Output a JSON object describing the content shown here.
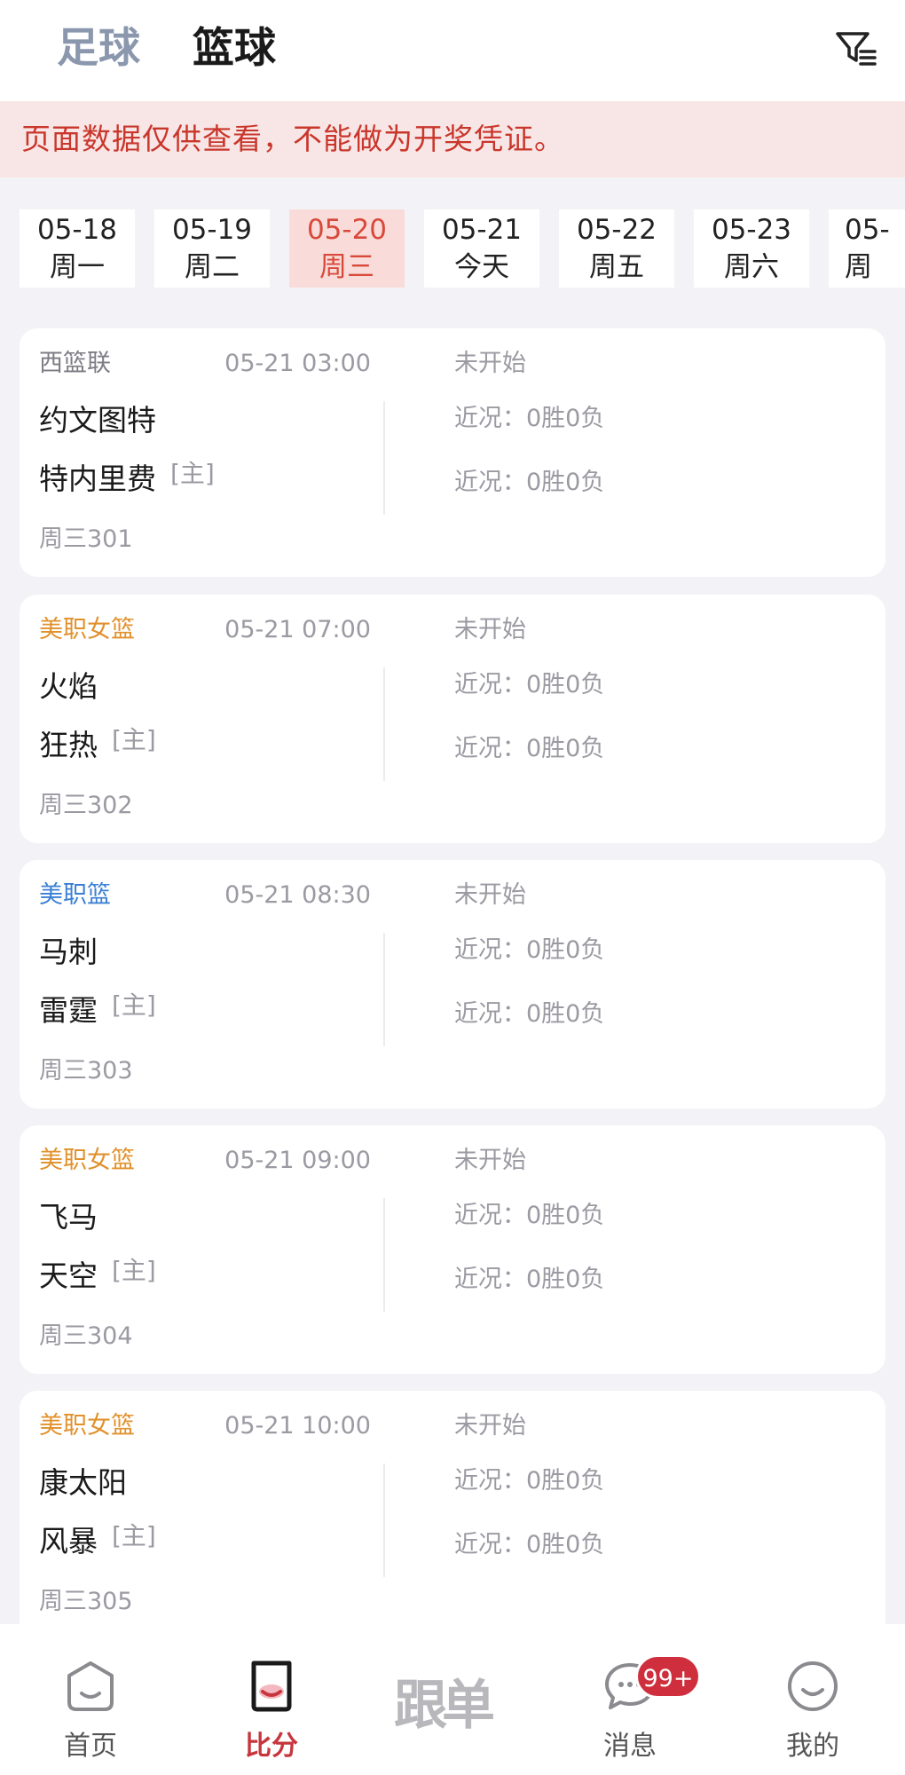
{
  "header": {
    "tabs": [
      "足球",
      "篮球"
    ],
    "selected_tab": "篮球",
    "filter_icon": "filter-icon"
  },
  "notice": "页面数据仅供查看，不能做为开奖凭证。",
  "dates": [
    {
      "date": "05-18",
      "day": "周一"
    },
    {
      "date": "05-19",
      "day": "周二"
    },
    {
      "date": "05-20",
      "day": "周三"
    },
    {
      "date": "05-21",
      "day": "今天"
    },
    {
      "date": "05-22",
      "day": "周五"
    },
    {
      "date": "05-23",
      "day": "周六"
    },
    {
      "date": "05-",
      "day": "周"
    }
  ],
  "selected_date": "05-20",
  "colors": {
    "accent": "#d8493b",
    "league_orange": "#e1912c",
    "league_blue": "#3a7fd4",
    "league_gray": "#7c7c84",
    "badge": "#cf2f3c"
  },
  "matches": [
    {
      "league": "西篮联",
      "league_color": "#7c7c84",
      "time": "05-21 03:00",
      "status": "未开始",
      "away": "约文图特",
      "home": "特内里费",
      "home_tag": "[主]",
      "away_record": "近况：0胜0负",
      "home_record": "近况：0胜0负",
      "number": "周三301"
    },
    {
      "league": "美职女篮",
      "league_color": "#e1912c",
      "time": "05-21 07:00",
      "status": "未开始",
      "away": "火焰",
      "home": "狂热",
      "home_tag": "[主]",
      "away_record": "近况：0胜0负",
      "home_record": "近况：0胜0负",
      "number": "周三302"
    },
    {
      "league": "美职篮",
      "league_color": "#3a7fd4",
      "time": "05-21 08:30",
      "status": "未开始",
      "away": "马刺",
      "home": "雷霆",
      "home_tag": "[主]",
      "away_record": "近况：0胜0负",
      "home_record": "近况：0胜0负",
      "number": "周三303"
    },
    {
      "league": "美职女篮",
      "league_color": "#e1912c",
      "time": "05-21 09:00",
      "status": "未开始",
      "away": "飞马",
      "home": "天空",
      "home_tag": "[主]",
      "away_record": "近况：0胜0负",
      "home_record": "近况：0胜0负",
      "number": "周三304"
    },
    {
      "league": "美职女篮",
      "league_color": "#e1912c",
      "time": "05-21 10:00",
      "status": "未开始",
      "away": "康太阳",
      "home": "风暴",
      "home_tag": "[主]",
      "away_record": "近况：0胜0负",
      "home_record": "近况：0胜0负",
      "number": "周三305"
    }
  ],
  "bottom_nav": {
    "items": [
      {
        "label": "首页",
        "icon": "home-icon"
      },
      {
        "label": "比分",
        "icon": "score-icon"
      },
      {
        "label": "跟单",
        "icon": "follow-order-icon"
      },
      {
        "label": "消息",
        "icon": "message-icon"
      },
      {
        "label": "我的",
        "icon": "profile-icon"
      }
    ],
    "active": "比分",
    "message_badge": "99+"
  }
}
